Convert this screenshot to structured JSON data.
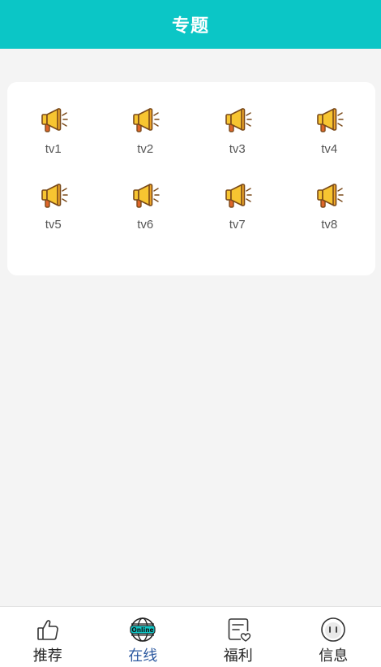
{
  "header": {
    "title": "专题"
  },
  "topics": [
    {
      "label": "tv1",
      "icon": "megaphone-icon"
    },
    {
      "label": "tv2",
      "icon": "megaphone-icon"
    },
    {
      "label": "tv3",
      "icon": "megaphone-icon"
    },
    {
      "label": "tv4",
      "icon": "megaphone-icon"
    },
    {
      "label": "tv5",
      "icon": "megaphone-icon"
    },
    {
      "label": "tv6",
      "icon": "megaphone-icon"
    },
    {
      "label": "tv7",
      "icon": "megaphone-icon"
    },
    {
      "label": "tv8",
      "icon": "megaphone-icon"
    }
  ],
  "tabbar": {
    "items": [
      {
        "label": "推荐",
        "icon": "thumbs-up-icon",
        "active": false
      },
      {
        "label": "在线",
        "icon": "online-globe-icon",
        "badge": "Online",
        "active": true
      },
      {
        "label": "福利",
        "icon": "note-heart-icon",
        "active": false
      },
      {
        "label": "信息",
        "icon": "message-face-icon",
        "active": false
      }
    ]
  },
  "colors": {
    "header_bg": "#0bc6c6",
    "page_bg": "#f4f4f4",
    "active_tab_text": "#2e5aa0",
    "megaphone_fill": "#f7c531"
  }
}
